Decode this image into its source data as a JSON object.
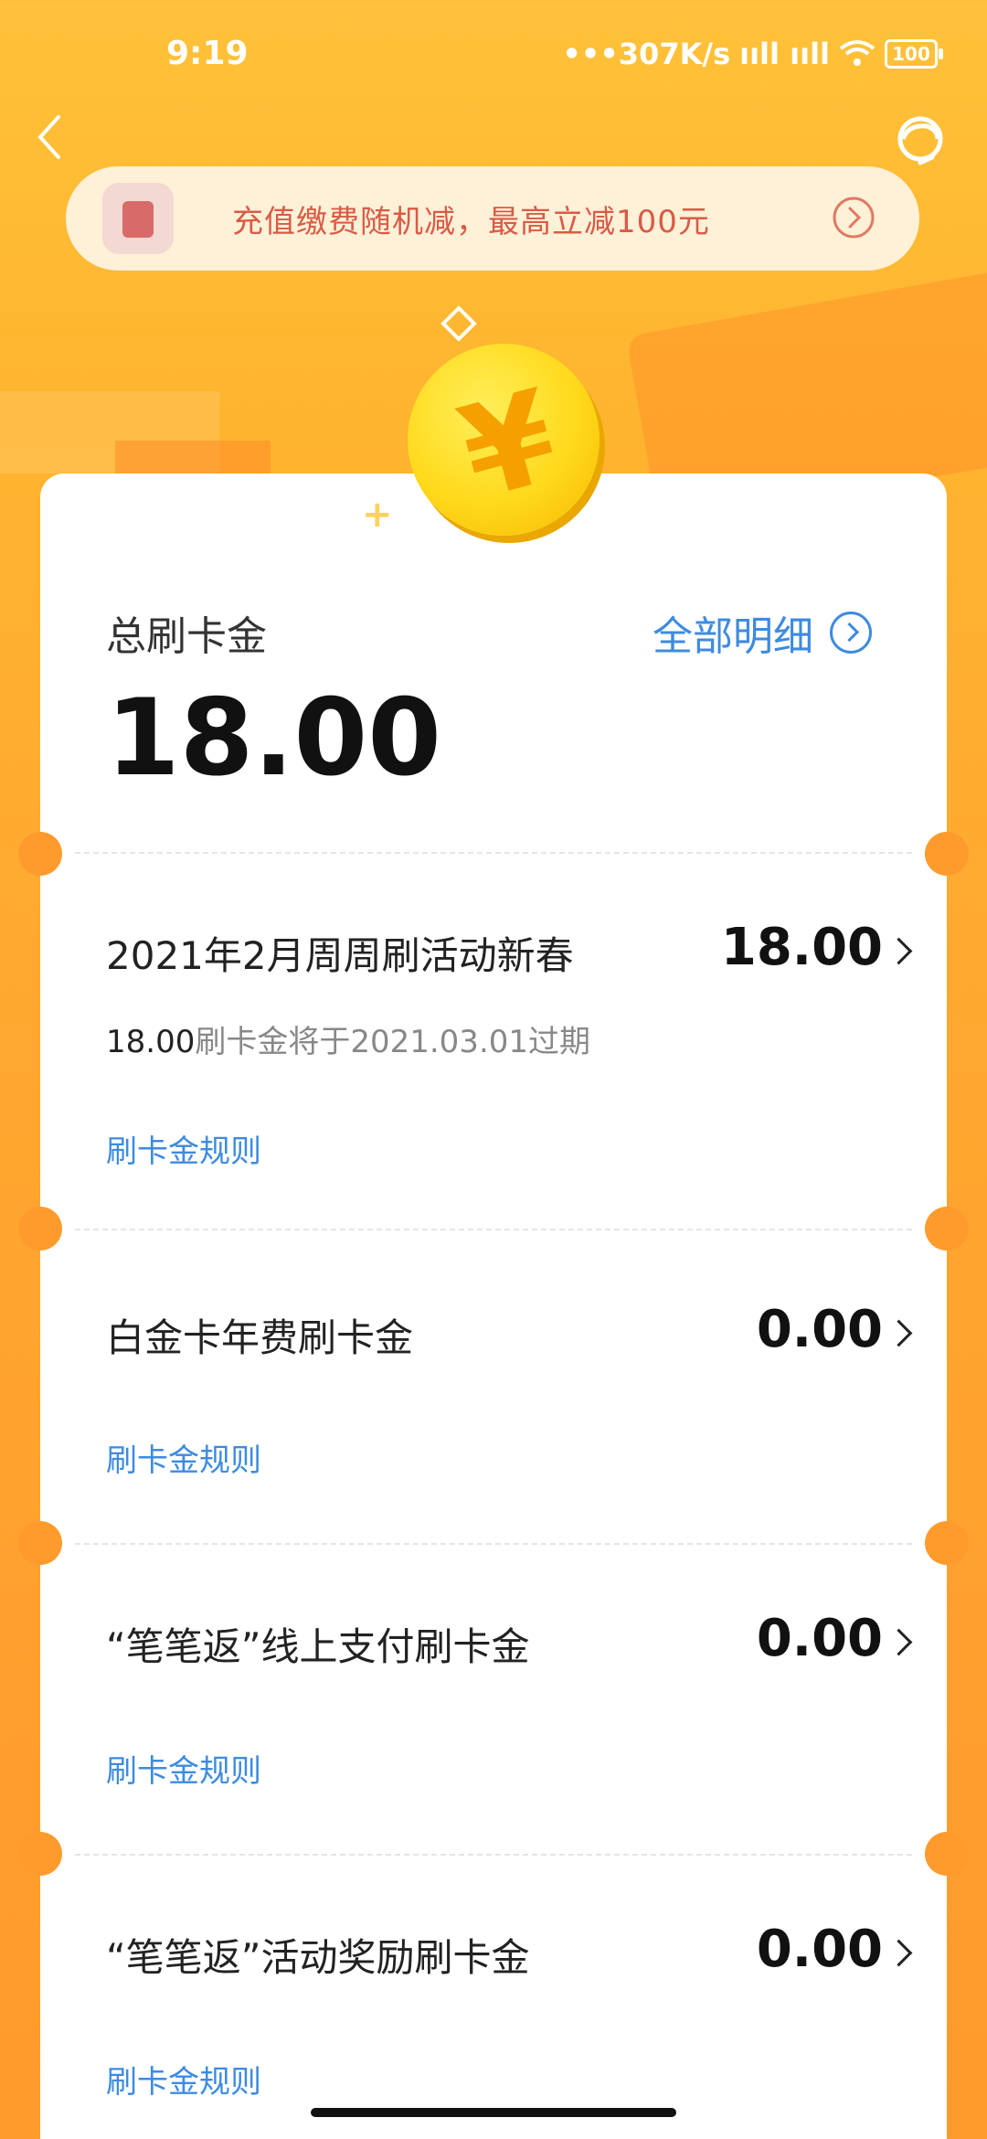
{
  "status_bar": {
    "time": "9:19",
    "network": "•••307K/s",
    "signal": "ııll ııll",
    "battery": "100"
  },
  "promo": {
    "text": "充值缴费随机减，最高立减100元",
    "icons": [
      "gift-icon",
      "chevron-right-circle-icon"
    ]
  },
  "summary": {
    "label": "总刷卡金",
    "value": "18.00",
    "detail_link": "全部明细"
  },
  "items": [
    {
      "title": "2021年2月周周刷活动新春",
      "value": "18.00",
      "sub_amount": "18.00",
      "sub_text": "刷卡金将于2021.03.01过期",
      "rule": "刷卡金规则"
    },
    {
      "title": "白金卡年费刷卡金",
      "value": "0.00",
      "rule": "刷卡金规则"
    },
    {
      "title": "“笔笔返”线上支付刷卡金",
      "value": "0.00",
      "rule": "刷卡金规则"
    },
    {
      "title": "“笔笔返”活动奖励刷卡金",
      "value": "0.00",
      "rule": "刷卡金规则"
    }
  ],
  "colors": {
    "accent": "#3d8be0",
    "background": "#ffb52f",
    "promo_text": "#d95b45"
  }
}
